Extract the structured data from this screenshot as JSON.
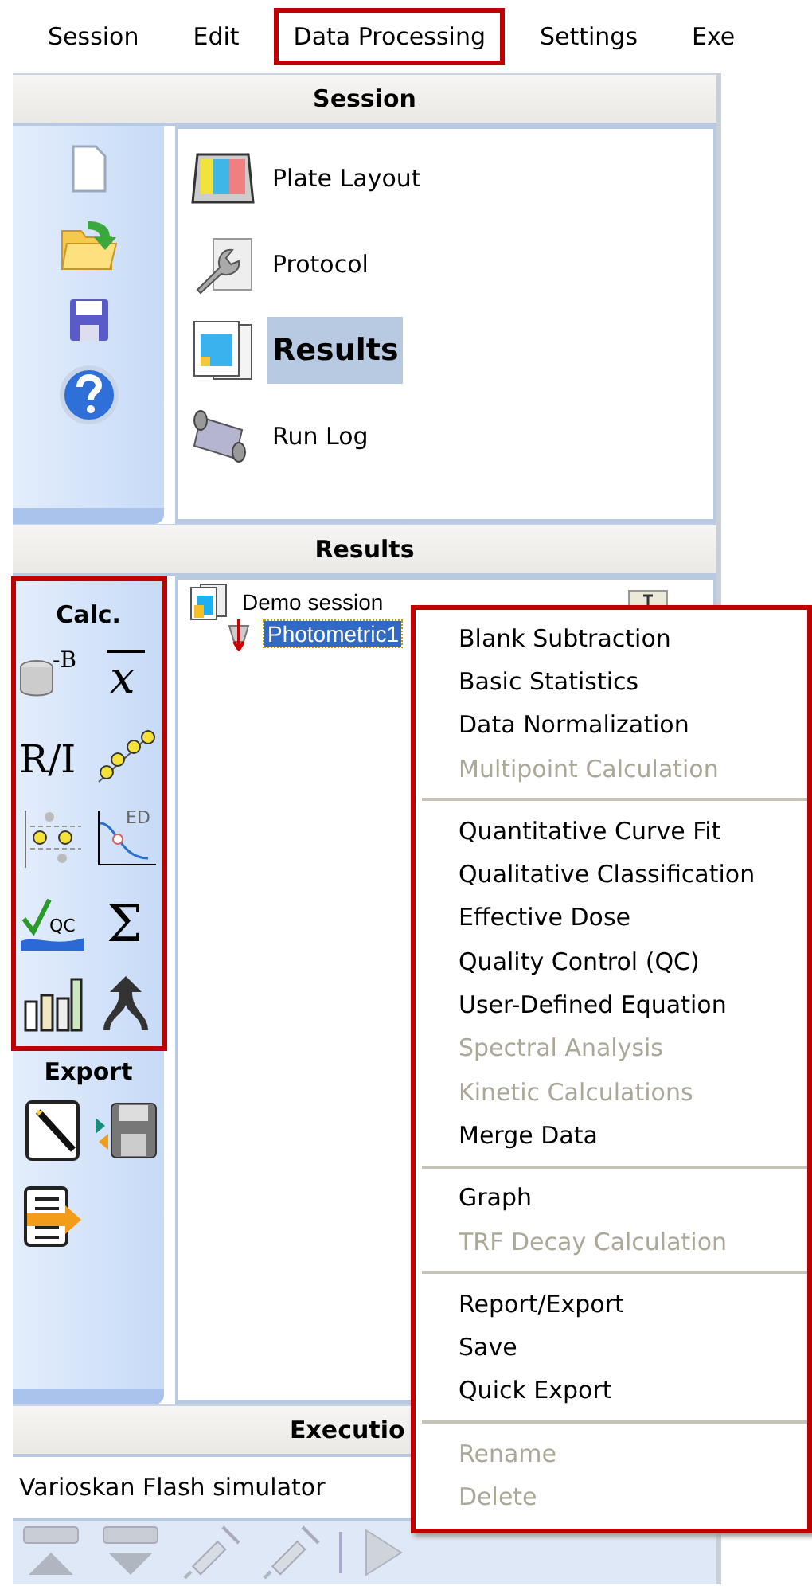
{
  "menu_bar": [
    {
      "label": "Session",
      "highlighted": false
    },
    {
      "label": "Edit",
      "highlighted": false
    },
    {
      "label": "Data Processing",
      "highlighted": true
    },
    {
      "label": "Settings",
      "highlighted": false
    },
    {
      "label": "Exe",
      "highlighted": false
    }
  ],
  "session_panel": {
    "title": "Session",
    "toolbar": [
      {
        "kind": "new"
      },
      {
        "kind": "open"
      },
      {
        "kind": "save"
      },
      {
        "kind": "help"
      }
    ],
    "items": [
      {
        "label": "Plate Layout",
        "kind": "plate",
        "selected": false
      },
      {
        "label": "Protocol",
        "kind": "protocol",
        "selected": false
      },
      {
        "label": "Results",
        "kind": "results",
        "selected": true
      },
      {
        "label": "Run Log",
        "kind": "log",
        "selected": false
      }
    ]
  },
  "results_panel": {
    "title": "Results",
    "calc": {
      "title": "Calc.",
      "highlighted": true,
      "tools": [
        {
          "kind": "blank",
          "label": "-B"
        },
        {
          "kind": "mean",
          "label": "x"
        },
        {
          "kind": "ratio",
          "label": "R/I"
        },
        {
          "kind": "curve"
        },
        {
          "kind": "classify"
        },
        {
          "kind": "dose",
          "label": "ED"
        },
        {
          "kind": "qc",
          "label": "QC"
        },
        {
          "kind": "sum",
          "label": "Σ"
        },
        {
          "kind": "bars"
        },
        {
          "kind": "merge"
        }
      ]
    },
    "export": {
      "title": "Export",
      "tools": [
        {
          "kind": "report"
        },
        {
          "kind": "disk"
        },
        {
          "kind": "list"
        }
      ]
    },
    "tree": [
      {
        "label": "Demo session",
        "selected": false,
        "children": [
          {
            "label": "Photometric1",
            "selected": true
          }
        ]
      }
    ]
  },
  "execution_panel": {
    "title": "Executio",
    "instrument": "Varioskan Flash simulator",
    "toolbar": [
      {
        "kind": "plate_in"
      },
      {
        "kind": "plate_out"
      },
      {
        "kind": "syringe"
      },
      {
        "kind": "syringe"
      },
      {
        "kind": "separator"
      },
      {
        "kind": "play"
      }
    ]
  },
  "context_menu": {
    "highlighted": true,
    "entries": [
      {
        "kind": "item",
        "label": "Blank Subtraction",
        "disabled": false
      },
      {
        "kind": "item",
        "label": "Basic Statistics",
        "disabled": false
      },
      {
        "kind": "item",
        "label": "Data Normalization",
        "disabled": false
      },
      {
        "kind": "item",
        "label": "Multipoint Calculation",
        "disabled": true
      },
      {
        "kind": "separator"
      },
      {
        "kind": "item",
        "label": "Quantitative Curve Fit",
        "disabled": false
      },
      {
        "kind": "item",
        "label": "Qualitative Classification",
        "disabled": false
      },
      {
        "kind": "item",
        "label": "Effective Dose",
        "disabled": false
      },
      {
        "kind": "item",
        "label": "Quality Control (QC)",
        "disabled": false
      },
      {
        "kind": "item",
        "label": "User-Defined Equation",
        "disabled": false
      },
      {
        "kind": "item",
        "label": "Spectral Analysis",
        "disabled": true
      },
      {
        "kind": "item",
        "label": "Kinetic Calculations",
        "disabled": true
      },
      {
        "kind": "item",
        "label": "Merge Data",
        "disabled": false
      },
      {
        "kind": "separator"
      },
      {
        "kind": "item",
        "label": "Graph",
        "disabled": false
      },
      {
        "kind": "item",
        "label": "TRF Decay Calculation",
        "disabled": true
      },
      {
        "kind": "separator"
      },
      {
        "kind": "item",
        "label": "Report/Export",
        "disabled": false
      },
      {
        "kind": "item",
        "label": "Save",
        "disabled": false
      },
      {
        "kind": "item",
        "label": "Quick Export",
        "disabled": false
      },
      {
        "kind": "separator"
      },
      {
        "kind": "item",
        "label": "Rename",
        "disabled": true
      },
      {
        "kind": "item",
        "label": "Delete",
        "disabled": true
      }
    ]
  }
}
